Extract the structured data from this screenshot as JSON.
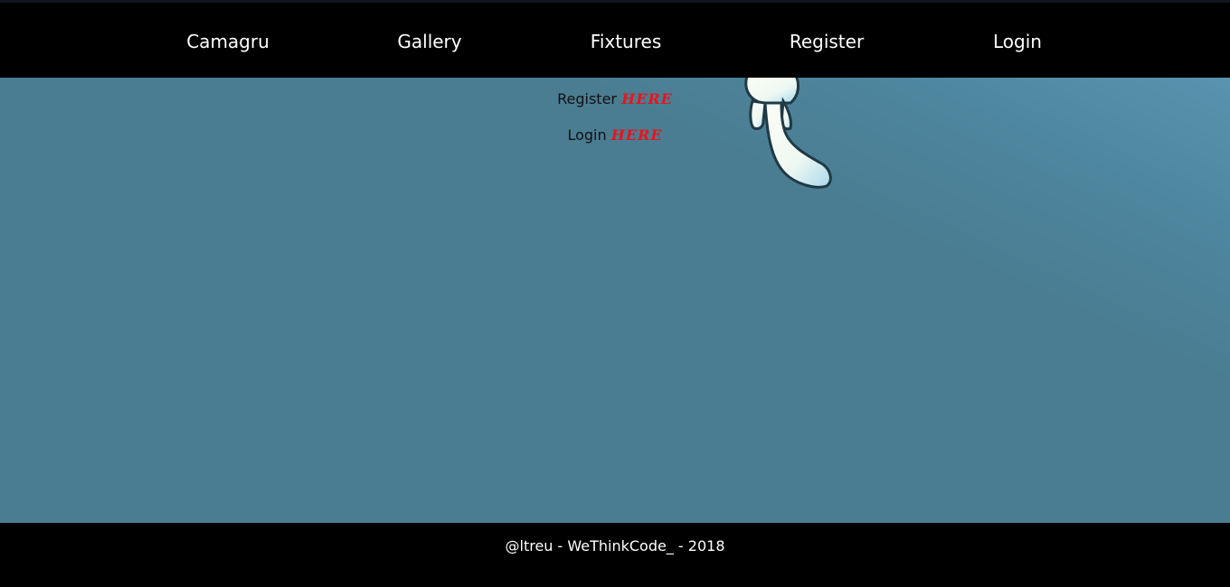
{
  "navbar": {
    "items": [
      {
        "label": "Camagru"
      },
      {
        "label": "Gallery"
      },
      {
        "label": "Fixtures"
      },
      {
        "label": "Register"
      },
      {
        "label": "Login"
      }
    ]
  },
  "main": {
    "register_line": {
      "text": "Register",
      "link": "HERE"
    },
    "login_line": {
      "text": "Login",
      "link": "HERE"
    }
  },
  "footer": {
    "text": "@ltreu - WeThinkCode_ - 2018"
  },
  "colors": {
    "background": "#4a7d92",
    "nav_background": "#000000",
    "link_accent": "#e8141c"
  }
}
